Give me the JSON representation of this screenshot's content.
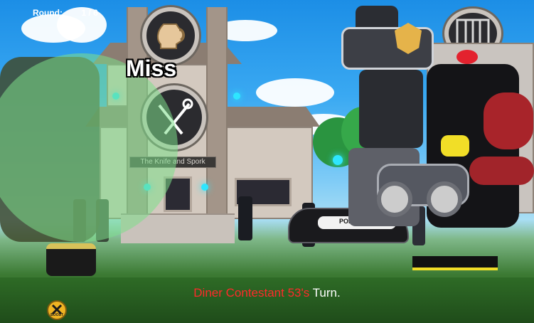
{
  "hud": {
    "round_label": "Round:",
    "round_value": "1 / 6"
  },
  "battle": {
    "result_text": "Miss",
    "building_sign": "The Knife and Spork",
    "police_label": "POLICE"
  },
  "turn": {
    "name": "Diner Contestant 53's",
    "suffix": " Turn."
  },
  "icons": {
    "boost_badge": "x-boost-icon",
    "boost_caption": "BOOST",
    "pitcher_sign": "pitcher-icon",
    "utensil_sign": "knife-fork-icon",
    "jail_sign": "jail-bars-icon"
  },
  "colors": {
    "sky": "#3aa9f2",
    "grass": "#2b5f22",
    "turn_name": "#ff2a2a",
    "turn_suffix": "#ffffff",
    "miss_text": "#ffffff",
    "heal_aura": "#7dde8a"
  }
}
